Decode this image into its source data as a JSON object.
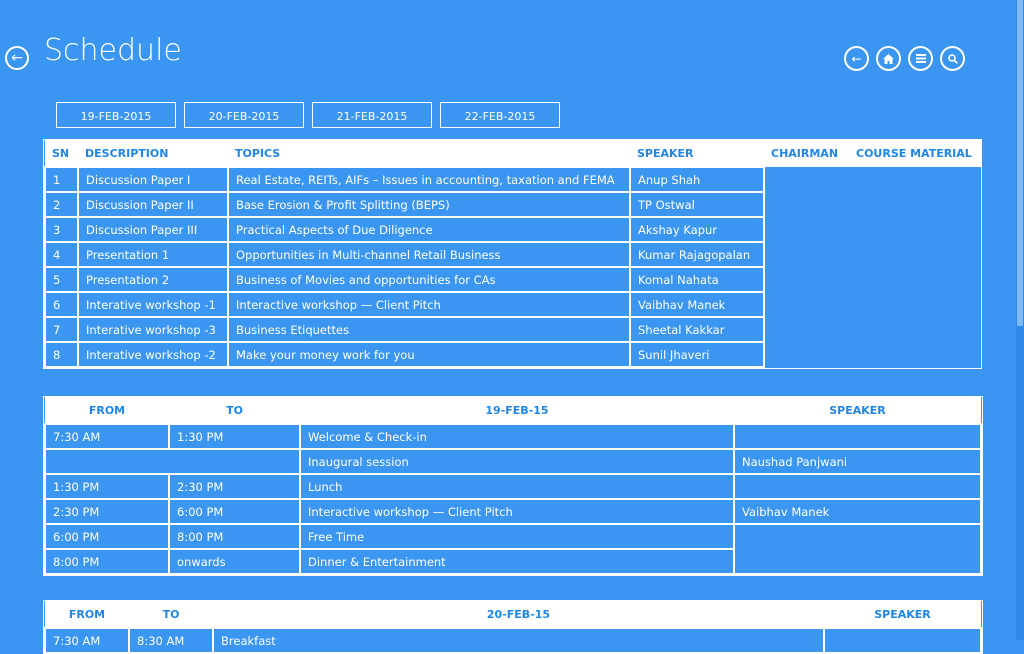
{
  "header": {
    "title": "Schedule"
  },
  "dates": [
    "19-FEB-2015",
    "20-FEB-2015",
    "21-FEB-2015",
    "22-FEB-2015"
  ],
  "sessions": {
    "headers": [
      "SN",
      "DESCRIPTION",
      "TOPICS",
      "SPEAKER",
      "CHAIRMAN",
      "COURSE MATERIAL"
    ],
    "rows": [
      {
        "sn": "1",
        "desc": "Discussion Paper I",
        "topic": "Real Estate, REITs, AIFs – Issues in accounting, taxation and FEMA",
        "speaker": "Anup Shah"
      },
      {
        "sn": "2",
        "desc": "Discussion Paper II",
        "topic": "Base Erosion & Profit Splitting (BEPS)",
        "speaker": "TP Ostwal"
      },
      {
        "sn": "3",
        "desc": "Discussion Paper III",
        "topic": "Practical Aspects of Due Diligence",
        "speaker": "Akshay Kapur"
      },
      {
        "sn": "4",
        "desc": "Presentation 1",
        "topic": "Opportunities in Multi-channel Retail Business",
        "speaker": "Kumar Rajagopalan"
      },
      {
        "sn": "5",
        "desc": "Presentation 2",
        "topic": "Business of Movies and opportunities for CAs",
        "speaker": "Komal Nahata"
      },
      {
        "sn": "6",
        "desc": "Interative workshop -1",
        "topic": "Interactive workshop — Client Pitch",
        "speaker": "Vaibhav Manek"
      },
      {
        "sn": "7",
        "desc": "Interative workshop -3",
        "topic": "Business Etiquettes",
        "speaker": "Sheetal Kakkar"
      },
      {
        "sn": "8",
        "desc": "Interative workshop -2",
        "topic": "Make your money work for you",
        "speaker": "Sunil Jhaveri"
      }
    ]
  },
  "day1": {
    "headers": {
      "from": "FROM",
      "to": "TO",
      "date": "19-FEB-15",
      "speaker": "SPEAKER"
    },
    "rows": [
      {
        "from": "7:30 AM",
        "to": "1:30 PM",
        "event": "Welcome & Check-in",
        "speaker": ""
      },
      {
        "from": "",
        "to": "",
        "event": "Inaugural session",
        "speaker": "Naushad Panjwani"
      },
      {
        "from": "1:30 PM",
        "to": "2:30 PM",
        "event": "Lunch",
        "speaker": ""
      },
      {
        "from": "2:30 PM",
        "to": "6:00 PM",
        "event": "Interactive workshop — Client Pitch",
        "speaker": "Vaibhav Manek"
      },
      {
        "from": "6:00 PM",
        "to": "8:00 PM",
        "event": "Free Time",
        "speaker": ""
      },
      {
        "from": "8:00 PM",
        "to": "onwards",
        "event": "Dinner & Entertainment",
        "speaker": ""
      }
    ]
  },
  "day2": {
    "headers": {
      "from": "FROM",
      "to": "TO",
      "date": "20-FEB-15",
      "speaker": "SPEAKER"
    },
    "rows": [
      {
        "from": "7:30 AM",
        "to": "8:30 AM",
        "event": "Breakfast",
        "speaker": ""
      }
    ]
  }
}
